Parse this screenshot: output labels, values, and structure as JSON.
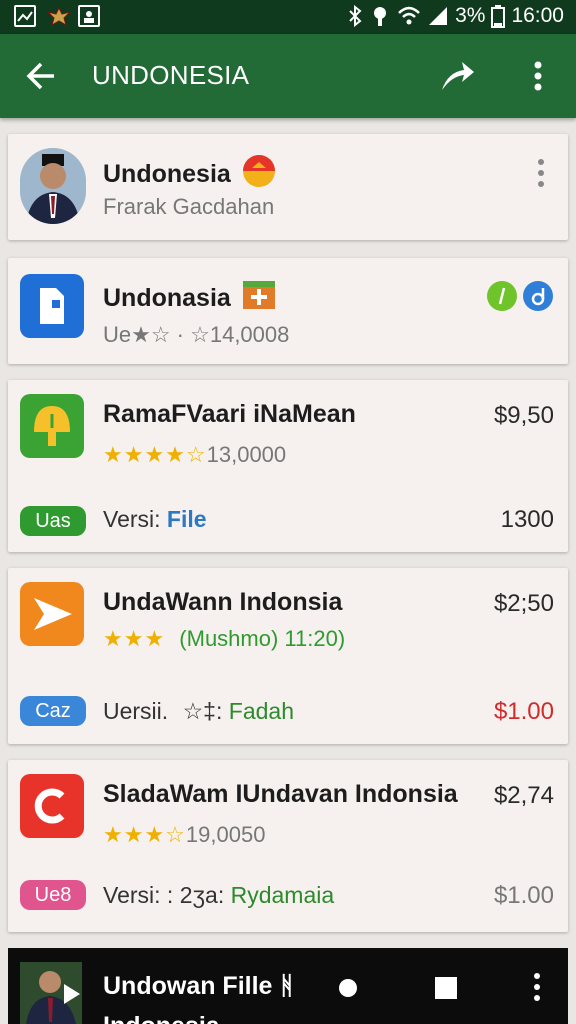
{
  "status_bar": {
    "battery": "3%",
    "time": "16:00"
  },
  "app_bar": {
    "title": "UNDONESIA"
  },
  "profile_card": {
    "name": "Undonesia",
    "subtitle": "Frarak Gacdahan"
  },
  "app_card": {
    "name": "Undonasia",
    "rating_text": "Ue★☆ · ☆14,0008"
  },
  "items": [
    {
      "name": "RamaFVaari iNaMean",
      "stars_filled": "★★★★",
      "stars_empty": "☆",
      "count": "13,0000",
      "price": "$9,50",
      "badge": "Uas",
      "badge_color": "#2f9a2f",
      "versi_label": "Versi:",
      "versi_value": "File",
      "versi_value_color": "#2b78c4",
      "right_value": "1300",
      "right_value_color": "#2a2a2a"
    },
    {
      "name": "UndaWann Indonsia",
      "stars_filled": "★★★",
      "stars_empty": "",
      "count": "(Mushmo) 11:20)",
      "price": "$2;50",
      "badge": "Caz",
      "badge_color": "#3a86d8",
      "versi_label": "Uersii.",
      "versi_extra": "☆‡:",
      "versi_value": "Fadah",
      "versi_value_color": "#2c8a2c",
      "right_value": "$1.00",
      "right_value_color": "#d22b2b"
    },
    {
      "name": "SladaWam IUndavan Indonsia",
      "stars_filled": "★★★",
      "stars_empty": "☆",
      "count": "19,0050",
      "price": "$2,74",
      "badge": "Ue8",
      "badge_color": "#e0558e",
      "versi_label": "Versi: :",
      "versi_extra": "2ʒa:",
      "versi_value": "Rydamaia",
      "versi_value_color": "#2c8a2c",
      "right_value": "$1.00",
      "right_value_color": "#777777"
    }
  ],
  "bottom_bar": {
    "title": "Undowan Fille ᚻ",
    "subtitle": "Indonesia"
  },
  "icons": [
    "back-arrow-icon",
    "share-icon",
    "more-vert-icon",
    "flag-icon",
    "play-icon"
  ],
  "colors": {
    "app_bar": "#226b36",
    "status_bar": "#0f3a1e",
    "card_bg": "#f6f1ee"
  }
}
